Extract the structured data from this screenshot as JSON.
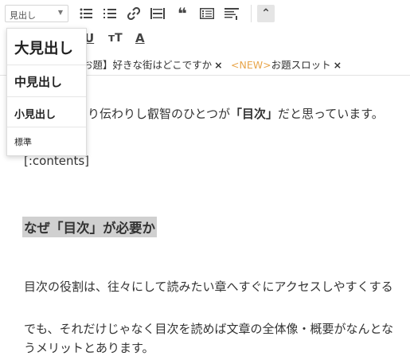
{
  "toolbar": {
    "format_select_value": "見出し",
    "icons": [
      "bullet-list-icon",
      "numbered-list-icon",
      "link-icon",
      "hr-icon",
      "blockquote-icon",
      "table-icon",
      "toc-icon"
    ],
    "quote_glyph": "❝",
    "collapse_glyph": "⌃"
  },
  "toolbar2": {
    "underline_label": "U",
    "font_size_label": "тT",
    "text_color_label": "A"
  },
  "tags": [
    {
      "text": "お題】好きな街はどこですか",
      "new": ""
    },
    {
      "text": "お題スロット",
      "new": "<NEW>"
    }
  ],
  "tag_close": "×",
  "editor": {
    "line1_pre": "り伝わりし叡智のひとつが",
    "line1_bold": "「目次」",
    "line1_post": "だと思っています。",
    "contents_tag": "[:contents]",
    "heading": "なぜ「目次」が必要か",
    "para1": "目次の役割は、往々にして読みたい章へすぐにアクセスしやすくする",
    "para2": "でも、それだけじゃなく目次を読めば文章の全体像・概要がなんとな",
    "para3": "うメリットとあります。"
  },
  "dropdown": {
    "items": [
      "大見出し",
      "中見出し",
      "小見出し",
      "標準"
    ]
  }
}
